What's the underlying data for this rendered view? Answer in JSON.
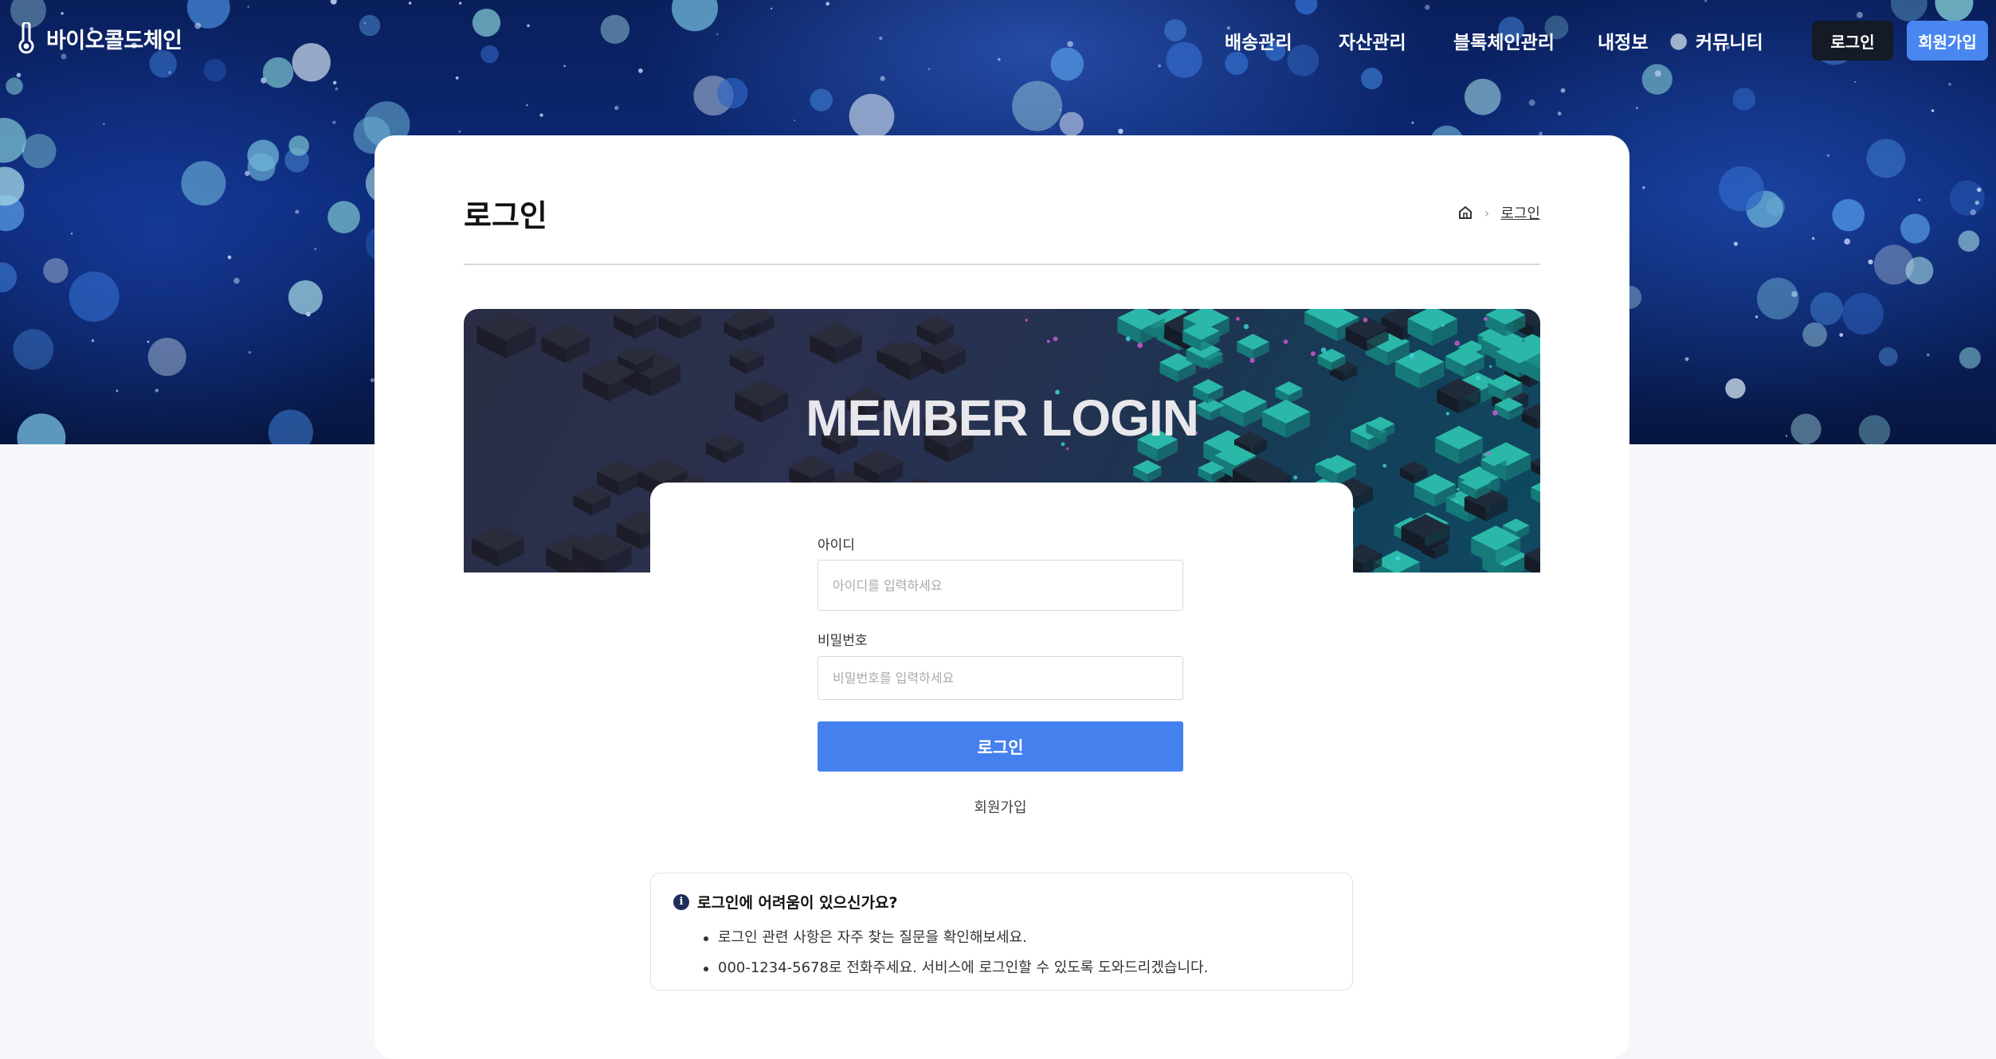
{
  "header": {
    "brand": "바이오콜드체인",
    "nav": [
      {
        "label": "배송관리"
      },
      {
        "label": "자산관리"
      },
      {
        "label": "블록체인관리"
      },
      {
        "label": "내정보"
      },
      {
        "label": "커뮤니티"
      }
    ],
    "login_button": "로그인",
    "join_button": "회원가입"
  },
  "page": {
    "title": "로그인",
    "breadcrumb": {
      "current": "로그인"
    }
  },
  "banner": {
    "title": "MEMBER LOGIN"
  },
  "form": {
    "id_label": "아이디",
    "id_placeholder": "아이디를 입력하세요",
    "password_label": "비밀번호",
    "password_placeholder": "비밀번호를 입력하세요",
    "submit_label": "로그인",
    "join_link": "회원가입"
  },
  "help": {
    "title": "로그인에 어려움이 있으신가요?",
    "items": [
      "로그인 관련 사항은 자주 찾는 질문을 확인해보세요.",
      "000-1234-5678로 전화주세요. 서비스에 로그인할 수 있도록 도와드리겠습니다."
    ]
  },
  "colors": {
    "primary": "#4580ef",
    "dark_button": "#141a26",
    "join_button": "#4a86f0"
  }
}
